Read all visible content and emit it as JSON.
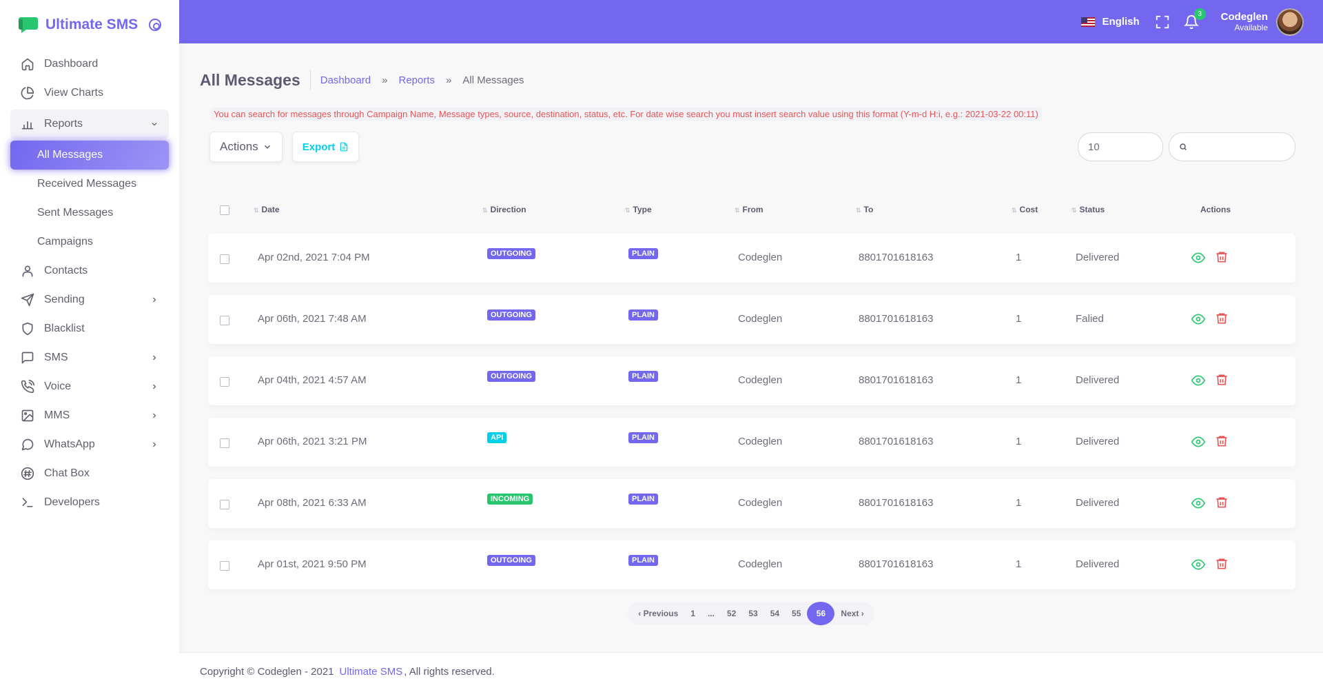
{
  "brand": {
    "name": "Ultimate SMS",
    "accent": "#7367f0"
  },
  "sidebar": {
    "items": [
      {
        "label": "Dashboard",
        "icon": "home-icon"
      },
      {
        "label": "View Charts",
        "icon": "pie-chart-icon"
      },
      {
        "label": "Reports",
        "icon": "bar-chart-icon",
        "expanded": true,
        "children": [
          "All Messages",
          "Received Messages",
          "Sent Messages",
          "Campaigns"
        ],
        "active_child": "All Messages"
      },
      {
        "label": "Contacts",
        "icon": "user-icon"
      },
      {
        "label": "Sending",
        "icon": "send-icon",
        "has_children": true
      },
      {
        "label": "Blacklist",
        "icon": "shield-icon"
      },
      {
        "label": "SMS",
        "icon": "message-square-icon",
        "has_children": true
      },
      {
        "label": "Voice",
        "icon": "phone-call-icon",
        "has_children": true
      },
      {
        "label": "MMS",
        "icon": "image-icon",
        "has_children": true
      },
      {
        "label": "WhatsApp",
        "icon": "message-circle-icon",
        "has_children": true
      },
      {
        "label": "Chat Box",
        "icon": "hash-icon"
      },
      {
        "label": "Developers",
        "icon": "terminal-icon"
      }
    ]
  },
  "header": {
    "language": "English",
    "notification_count": "3",
    "user_name": "Codeglen",
    "user_status": "Available"
  },
  "page": {
    "title": "All Messages",
    "breadcrumbs": [
      "Dashboard",
      "Reports",
      "All Messages"
    ],
    "breadcrumb_sep": "»",
    "notice": "You can search for messages through Campaign Name, Message types, source, destination, status, etc. For date wise search you must insert search value using this format (Y-m-d H:i, e.g.: 2021-03-22 00:11)"
  },
  "toolbar": {
    "actions_label": "Actions",
    "export_label": "Export",
    "page_length": "10",
    "search_value": ""
  },
  "table": {
    "columns": [
      "Date",
      "Direction",
      "Type",
      "From",
      "To",
      "Cost",
      "Status",
      "Actions"
    ],
    "rows": [
      {
        "date": "Apr 02nd, 2021 7:04 PM",
        "direction": "OUTGOING",
        "type": "PLAIN",
        "from": "Codeglen",
        "to": "8801701618163",
        "cost": "1",
        "status": "Delivered"
      },
      {
        "date": "Apr 06th, 2021 7:48 AM",
        "direction": "OUTGOING",
        "type": "PLAIN",
        "from": "Codeglen",
        "to": "8801701618163",
        "cost": "1",
        "status": "Falied"
      },
      {
        "date": "Apr 04th, 2021 4:57 AM",
        "direction": "OUTGOING",
        "type": "PLAIN",
        "from": "Codeglen",
        "to": "8801701618163",
        "cost": "1",
        "status": "Delivered"
      },
      {
        "date": "Apr 06th, 2021 3:21 PM",
        "direction": "API",
        "type": "PLAIN",
        "from": "Codeglen",
        "to": "8801701618163",
        "cost": "1",
        "status": "Delivered"
      },
      {
        "date": "Apr 08th, 2021 6:33 AM",
        "direction": "INCOMING",
        "type": "PLAIN",
        "from": "Codeglen",
        "to": "8801701618163",
        "cost": "1",
        "status": "Delivered"
      },
      {
        "date": "Apr 01st, 2021 9:50 PM",
        "direction": "OUTGOING",
        "type": "PLAIN",
        "from": "Codeglen",
        "to": "8801701618163",
        "cost": "1",
        "status": "Delivered"
      }
    ],
    "direction_colors": {
      "OUTGOING": "#7367f0",
      "API": "#00cfe8",
      "INCOMING": "#28c76f"
    },
    "type_color": "#7367f0"
  },
  "pagination": {
    "previous": "Previous",
    "next": "Next",
    "pages": [
      "1",
      "...",
      "52",
      "53",
      "54",
      "55",
      "56"
    ],
    "current": "56"
  },
  "footer": {
    "prefix": "Copyright © Codeglen - 2021",
    "brand": "Ultimate SMS",
    "suffix": ", All rights reserved."
  }
}
